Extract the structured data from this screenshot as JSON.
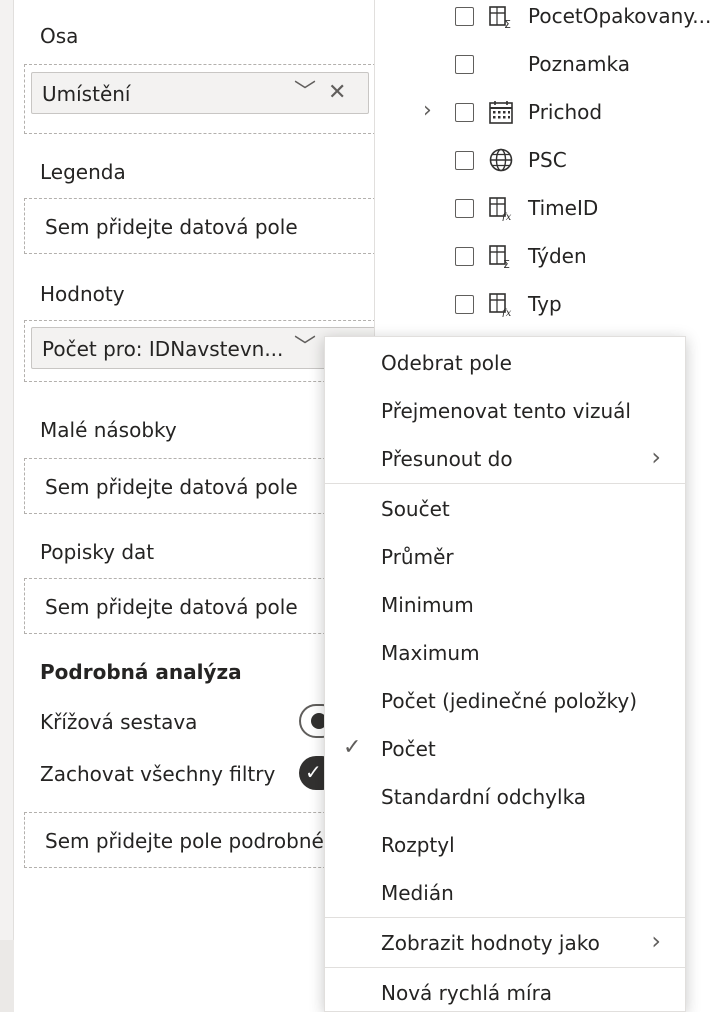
{
  "filters": {
    "axis_label": "Osa",
    "axis_field": "Umístění",
    "legend_label": "Legenda",
    "legend_placeholder": "Sem přidejte datová pole",
    "values_label": "Hodnoty",
    "values_field": "Počet pro: IDNavstevn...",
    "small_multiples_label": "Malé násobky",
    "small_multiples_placeholder": "Sem přidejte datová pole",
    "data_labels_label": "Popisky dat",
    "data_labels_placeholder": "Sem přidejte datová pole",
    "drillthrough_label": "Podrobná analýza",
    "cross_report_label": "Křížová sestava",
    "keep_filters_label": "Zachovat všechny filtry",
    "drillthrough_placeholder": "Sem přidejte pole podrobné"
  },
  "fields": [
    {
      "name": "PocetOpakovany...",
      "icon": "calc-table-icon",
      "checked": false,
      "expandable": false
    },
    {
      "name": "Poznamka",
      "icon": "none",
      "checked": false,
      "expandable": false
    },
    {
      "name": "Prichod",
      "icon": "calendar-icon",
      "checked": false,
      "expandable": true
    },
    {
      "name": "PSC",
      "icon": "globe-icon",
      "checked": false,
      "expandable": false
    },
    {
      "name": "TimeID",
      "icon": "calc-column-icon",
      "checked": false,
      "expandable": false
    },
    {
      "name": "Týden",
      "icon": "sum-column-icon",
      "checked": false,
      "expandable": false
    },
    {
      "name": "Typ",
      "icon": "calc-column-icon",
      "checked": false,
      "expandable": false
    }
  ],
  "context_menu": {
    "remove_field": "Odebrat pole",
    "rename": "Přejmenovat tento vizuál",
    "move_to": "Přesunout do",
    "sum": "Součet",
    "average": "Průměr",
    "minimum": "Minimum",
    "maximum": "Maximum",
    "count_distinct": "Počet (jedinečné položky)",
    "count": "Počet",
    "std_dev": "Standardní odchylka",
    "variance": "Rozptyl",
    "median": "Medián",
    "show_value_as": "Zobrazit hodnoty jako",
    "new_quick_measure": "Nová rychlá míra"
  },
  "selected_aggregation": "Počet"
}
